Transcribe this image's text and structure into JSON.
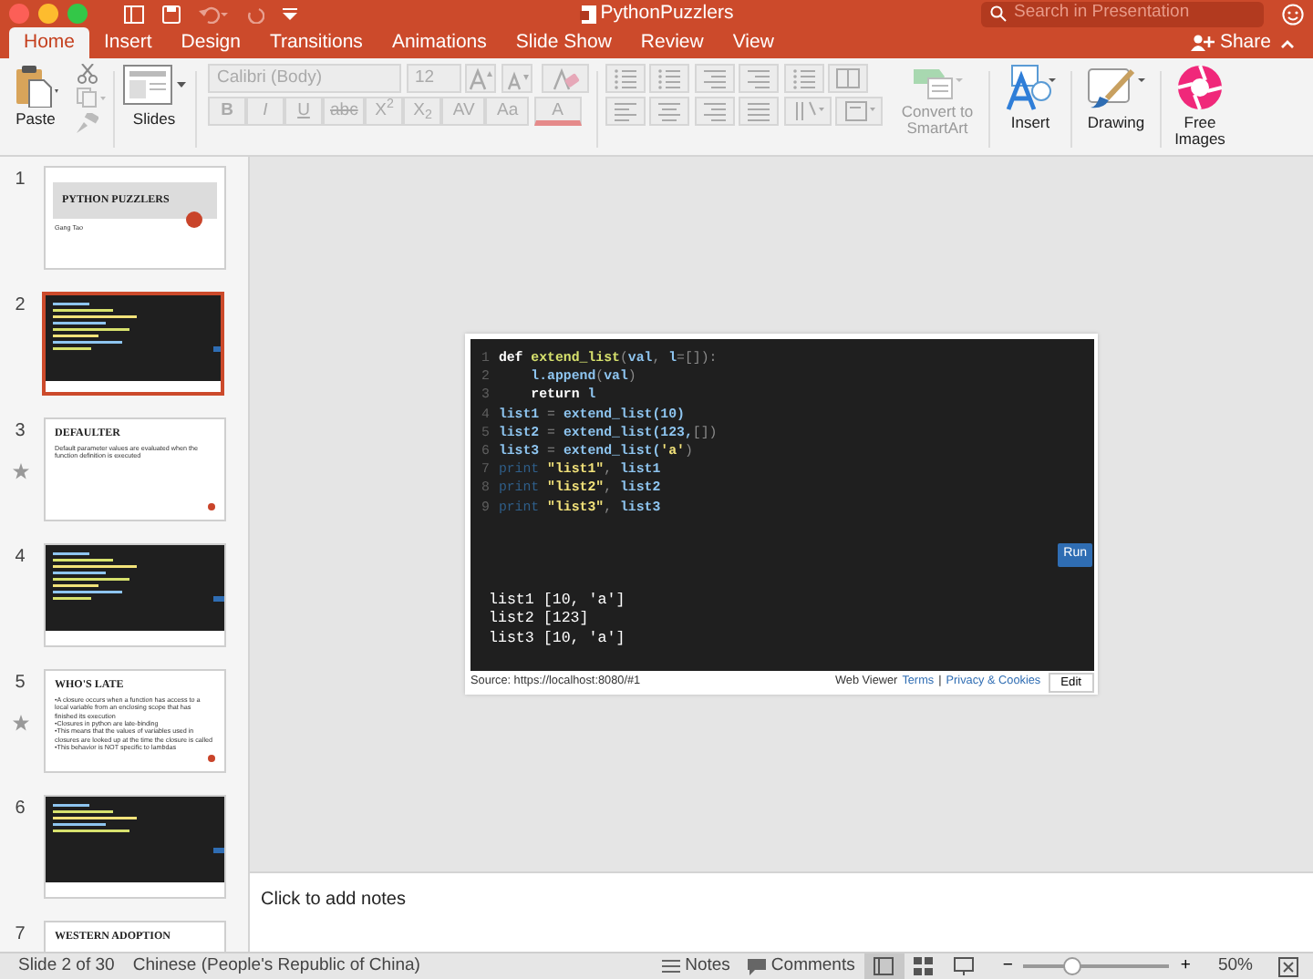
{
  "window": {
    "title": "PythonPuzzlers",
    "search": {
      "placeholder": "Search in Presentation"
    },
    "share": "Share"
  },
  "tabs": [
    {
      "label": "Home",
      "selected": true
    },
    {
      "label": "Insert",
      "selected": false
    },
    {
      "label": "Design",
      "selected": false
    },
    {
      "label": "Transitions",
      "selected": false
    },
    {
      "label": "Animations",
      "selected": false
    },
    {
      "label": "Slide Show",
      "selected": false
    },
    {
      "label": "Review",
      "selected": false
    },
    {
      "label": "View",
      "selected": false
    }
  ],
  "ribbon": {
    "paste": "Paste",
    "slides": "Slides",
    "font": {
      "value": "Calibri (Body)"
    },
    "size": {
      "value": "12"
    },
    "format_buttons": [
      "B",
      "I",
      "U",
      "abc",
      "X$^{2}$",
      "X$_{2}$",
      "AV",
      "Aa"
    ],
    "font_color": "A",
    "convert": "Convert to SmartArt",
    "insert": "Insert",
    "drawing": "Drawing",
    "free_images": "Free Images"
  },
  "thumbnails": [
    {
      "number": "1",
      "kind": "title",
      "selected": false,
      "starred": false,
      "title": "PYTHON PUZZLERS",
      "lines": [
        "Gang Tao"
      ]
    },
    {
      "number": "2",
      "kind": "code",
      "selected": true,
      "starred": false
    },
    {
      "number": "3",
      "kind": "text",
      "selected": false,
      "starred": true,
      "title": "DEFAULTER",
      "lines": [
        "Default parameter values are evaluated when the function definition is executed"
      ]
    },
    {
      "number": "4",
      "kind": "code",
      "selected": false,
      "starred": false
    },
    {
      "number": "5",
      "kind": "text",
      "selected": false,
      "starred": true,
      "title": "WHO'S LATE",
      "lines": [
        "•A closure occurs when a function has access to a local variable from an enclosing scope that has finished its execution",
        "•Closures in python are late-binding",
        "•This means that the values of variables used in closures are looked up at the time the closure is called",
        "•This behavior is NOT specific to lambdas"
      ]
    },
    {
      "number": "6",
      "kind": "code",
      "selected": false,
      "starred": false
    },
    {
      "number": "7",
      "kind": "text",
      "selected": false,
      "starred": false,
      "title": "WESTERN ADOPTION"
    }
  ],
  "slide": {
    "code": [
      {
        "number": "1",
        "tokens": [
          {
            "text": "def",
            "kind": "kw"
          },
          {
            "text": " extend_list",
            "kind": "fn"
          },
          {
            "text": "(",
            "kind": "punct"
          },
          {
            "text": "val",
            "kind": "var"
          },
          {
            "text": ", ",
            "kind": "punct"
          },
          {
            "text": "l",
            "kind": "var"
          },
          {
            "text": "=[]):",
            "kind": "punct"
          }
        ]
      },
      {
        "number": "2",
        "tokens": [
          {
            "text": "    l.append",
            "kind": "var"
          },
          {
            "text": "(",
            "kind": "punct"
          },
          {
            "text": "val",
            "kind": "var"
          },
          {
            "text": ")",
            "kind": "punct"
          }
        ]
      },
      {
        "number": "3",
        "tokens": [
          {
            "text": "    return",
            "kind": "kw"
          },
          {
            "text": " l",
            "kind": "var"
          }
        ]
      },
      {
        "number": "4",
        "tokens": [
          {
            "text": "list1",
            "kind": "var"
          },
          {
            "text": " = ",
            "kind": "punct"
          },
          {
            "text": "extend_list(10)",
            "kind": "var"
          }
        ]
      },
      {
        "number": "5",
        "tokens": [
          {
            "text": "list2",
            "kind": "var"
          },
          {
            "text": " = ",
            "kind": "punct"
          },
          {
            "text": "extend_list(123,",
            "kind": "var"
          },
          {
            "text": "[])",
            "kind": "punct"
          }
        ]
      },
      {
        "number": "6",
        "tokens": [
          {
            "text": "list3",
            "kind": "var"
          },
          {
            "text": " = ",
            "kind": "punct"
          },
          {
            "text": "extend_list(",
            "kind": "var"
          },
          {
            "text": "'a'",
            "kind": "str"
          },
          {
            "text": ")",
            "kind": "punct"
          }
        ]
      },
      {
        "number": "7",
        "tokens": [
          {
            "text": "print",
            "kind": "builtin"
          },
          {
            "text": " \"list1\"",
            "kind": "str"
          },
          {
            "text": ", ",
            "kind": "punct"
          },
          {
            "text": "list1",
            "kind": "var"
          }
        ]
      },
      {
        "number": "8",
        "tokens": [
          {
            "text": "print",
            "kind": "builtin"
          },
          {
            "text": " \"list2\"",
            "kind": "str"
          },
          {
            "text": ", ",
            "kind": "punct"
          },
          {
            "text": "list2",
            "kind": "var"
          }
        ]
      },
      {
        "number": "9",
        "tokens": [
          {
            "text": "print",
            "kind": "builtin"
          },
          {
            "text": " \"list3\"",
            "kind": "str"
          },
          {
            "text": ", ",
            "kind": "punct"
          },
          {
            "text": "list3",
            "kind": "var"
          }
        ]
      }
    ],
    "run": "Run",
    "output": [
      "list1 [10, 'a']",
      "list2 [123]",
      "list3 [10, 'a']"
    ],
    "source": "Source: https://localhost:8080/#1",
    "viewer": "Web Viewer",
    "terms": "Terms",
    "separator": "|",
    "privacy": "Privacy & Cookies",
    "edit": "Edit"
  },
  "notes": {
    "placeholder": "Click to add notes"
  },
  "status_bar": {
    "slide": "Slide 2 of 30",
    "language": "Chinese (People's Republic of China)",
    "notes": "Notes",
    "comments": "Comments",
    "views": [
      {
        "kind": "normal",
        "selected": true
      },
      {
        "kind": "sorter",
        "selected": false
      },
      {
        "kind": "reading",
        "selected": false
      }
    ],
    "zoom_out": "−",
    "zoom_in": "+",
    "zoom": {
      "level": 0.33
    },
    "zoom_label": "50%"
  }
}
